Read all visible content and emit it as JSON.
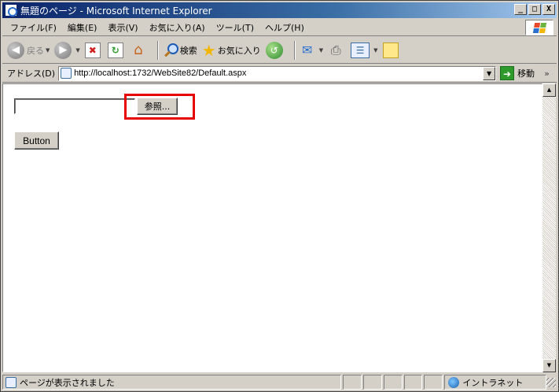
{
  "window": {
    "title": "無題のページ - Microsoft Internet Explorer",
    "minimize": "_",
    "maximize": "□",
    "close": "X"
  },
  "menubar": {
    "items": [
      "ファイル(F)",
      "編集(E)",
      "表示(V)",
      "お気に入り(A)",
      "ツール(T)",
      "ヘルプ(H)"
    ]
  },
  "toolbar": {
    "back_label": "戻る",
    "search_label": "検索",
    "favorites_label": "お気に入り"
  },
  "addressbar": {
    "label": "アドレス(D)",
    "url": "http://localhost:1732/WebSite82/Default.aspx",
    "go_label": "移動",
    "links_chevron": "»"
  },
  "page": {
    "file_input_value": "",
    "browse_label": "参照...",
    "button_label": "Button"
  },
  "statusbar": {
    "message": "ページが表示されました",
    "zone": "イントラネット"
  },
  "colors": {
    "highlight": "#e60000",
    "titlebar_start": "#0a246a",
    "titlebar_end": "#a6caf0"
  }
}
